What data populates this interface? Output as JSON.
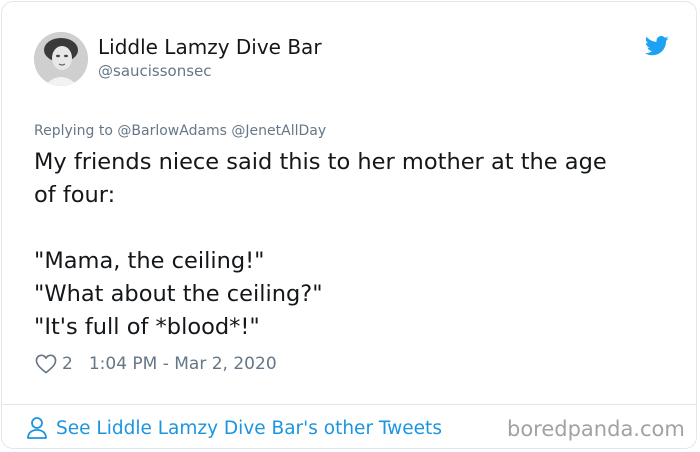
{
  "tweet": {
    "display_name": "Liddle Lamzy Dive Bar",
    "handle": "@saucissonsec",
    "replying_prefix": "Replying to",
    "replying_to": [
      "@BarlowAdams",
      "@JenetAllDay"
    ],
    "text_lines": [
      "My friends niece said this to her mother at the age",
      "of four:",
      "",
      "\"Mama, the ceiling!\"",
      "\"What about the ceiling?\"",
      "\"It's full of *blood*!\""
    ],
    "like_count": "2",
    "timestamp": "1:04 PM - Mar 2, 2020",
    "see_more_label": "See Liddle Lamzy Dive Bar's other Tweets"
  },
  "watermark": "boredpanda.com",
  "icons": {
    "platform": "twitter-bird-icon",
    "like": "heart-icon",
    "profile": "person-icon"
  },
  "colors": {
    "accent": "#1da1f2",
    "link": "#1b95e0",
    "secondary_text": "#657786",
    "primary_text": "#14171a",
    "border": "#e1e8ed"
  }
}
